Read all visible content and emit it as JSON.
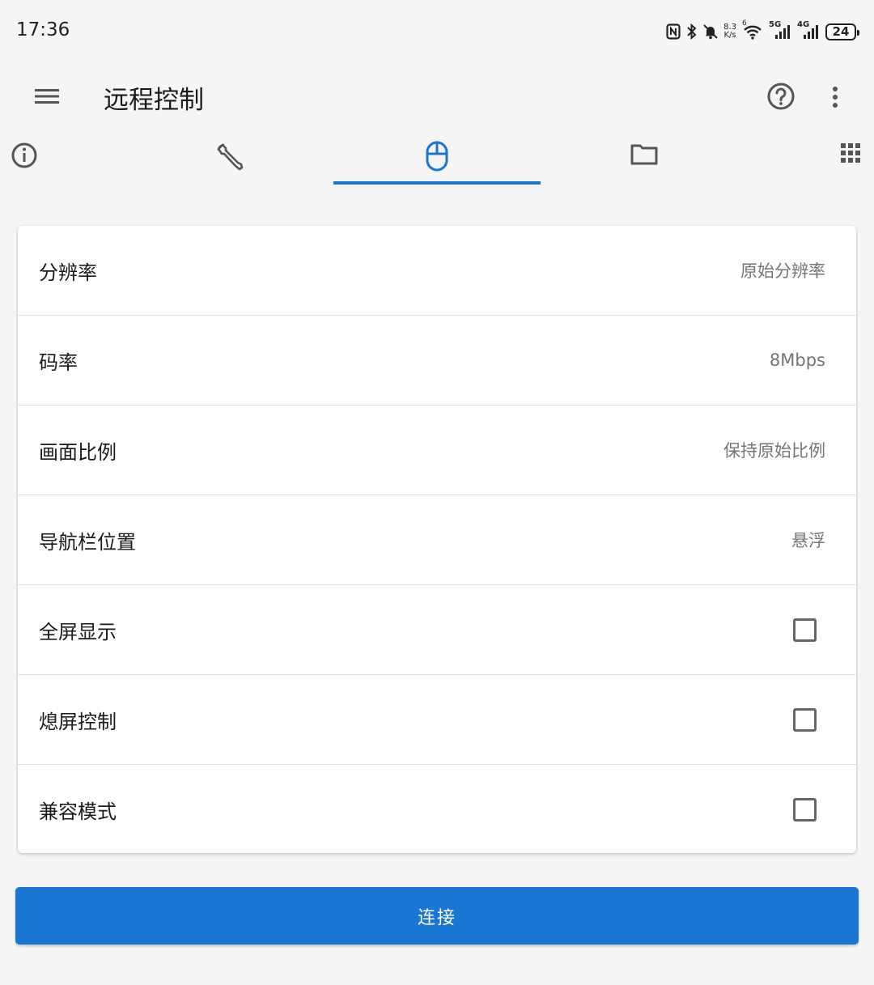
{
  "status_bar": {
    "time": "17:36",
    "net_speed_value": "8.3",
    "net_speed_unit": "K/s",
    "wifi_badge": "6",
    "signal1_label": "5G",
    "signal2_label": "4G",
    "battery": "24"
  },
  "app_bar": {
    "title": "远程控制"
  },
  "tabs": [
    {
      "icon": "info-icon",
      "active": false
    },
    {
      "icon": "wrench-icon",
      "active": false
    },
    {
      "icon": "mouse-icon",
      "active": true
    },
    {
      "icon": "folder-icon",
      "active": false
    },
    {
      "icon": "grid-icon",
      "active": false
    }
  ],
  "settings": {
    "resolution": {
      "label": "分辨率",
      "value": "原始分辨率"
    },
    "bitrate": {
      "label": "码率",
      "value": "8Mbps"
    },
    "aspect_ratio": {
      "label": "画面比例",
      "value": "保持原始比例"
    },
    "navbar_position": {
      "label": "导航栏位置",
      "value": "悬浮"
    },
    "fullscreen": {
      "label": "全屏显示",
      "checked": false
    },
    "screen_off_control": {
      "label": "熄屏控制",
      "checked": false
    },
    "compat_mode": {
      "label": "兼容模式",
      "checked": false
    }
  },
  "connect_button": {
    "label": "连接"
  },
  "colors": {
    "accent": "#1976d2",
    "icon_gray": "#555555",
    "background": "#f5f5f5"
  }
}
